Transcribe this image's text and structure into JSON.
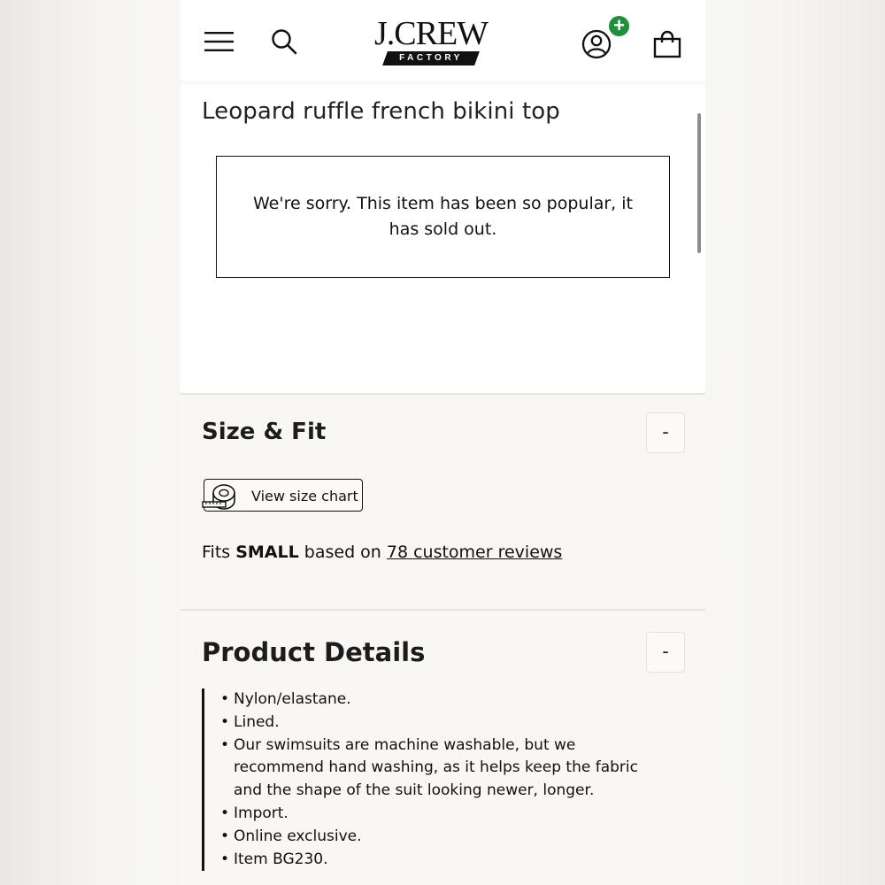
{
  "header": {
    "logo_main": "J.CREW",
    "logo_sub": "FACTORY",
    "account_badge": "+"
  },
  "product": {
    "title": "Leopard ruffle french bikini top",
    "soldout_message": "We're sorry. This item has been so popular, it has sold out."
  },
  "size_fit": {
    "title": "Size & Fit",
    "toggle": "-",
    "size_chart_label": "View size chart",
    "fits_prefix": "Fits ",
    "fits_value": "SMALL",
    "fits_middle": " based on ",
    "reviews_link": "78 customer reviews"
  },
  "product_details": {
    "title": "Product Details",
    "toggle": "-",
    "items": [
      "Nylon/elastane.",
      "Lined.",
      "Our swimsuits are machine washable, but we recommend hand washing, as it helps keep the fabric and the shape of the suit looking newer, longer.",
      "Import.",
      "Online exclusive.",
      "Item BG230."
    ]
  },
  "icons": [
    "menu-icon",
    "search-icon",
    "account-icon",
    "plus-icon",
    "bag-icon",
    "measuring-tape-icon"
  ],
  "colors": {
    "badge_green": "#1f8f3c",
    "page_bg": "#f8f7f4",
    "text": "#111111"
  }
}
